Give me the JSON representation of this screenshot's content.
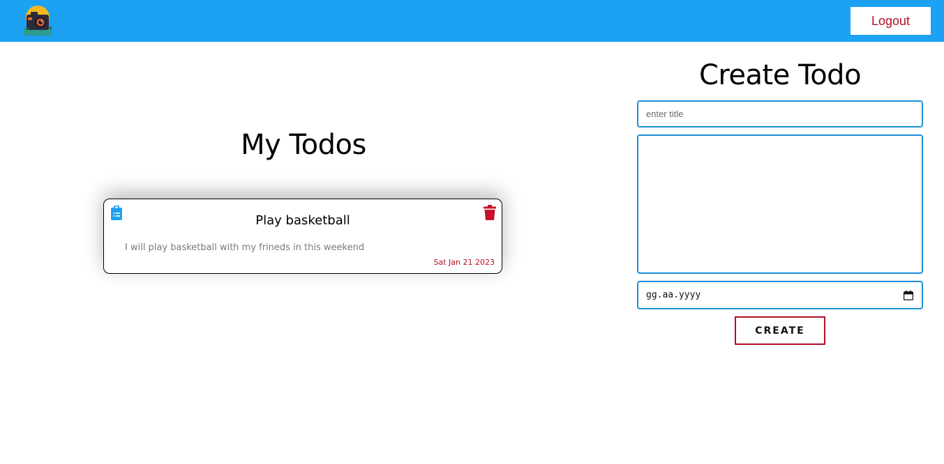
{
  "header": {
    "logo_icon": "camera-logo-icon",
    "logout_label": "Logout",
    "bg_color": "#1da1f2",
    "logout_color": "#b30e24"
  },
  "todos": {
    "heading": "My Todos",
    "items": [
      {
        "icon": "clipboard-list-icon",
        "title": "Play basketball",
        "description": "I will play basketball with my frineds in this weekend",
        "date": "Sat Jan 21 2023",
        "delete_icon": "trash-icon"
      }
    ]
  },
  "create_form": {
    "heading": "Create Todo",
    "title_placeholder": "enter title",
    "title_value": "",
    "description_value": "",
    "date_placeholder": "gg.aa.yyyy",
    "calendar_icon": "calendar-icon",
    "submit_label": "CREATE",
    "accent_color": "#1e8fd8",
    "button_border_color": "#b30e24"
  }
}
